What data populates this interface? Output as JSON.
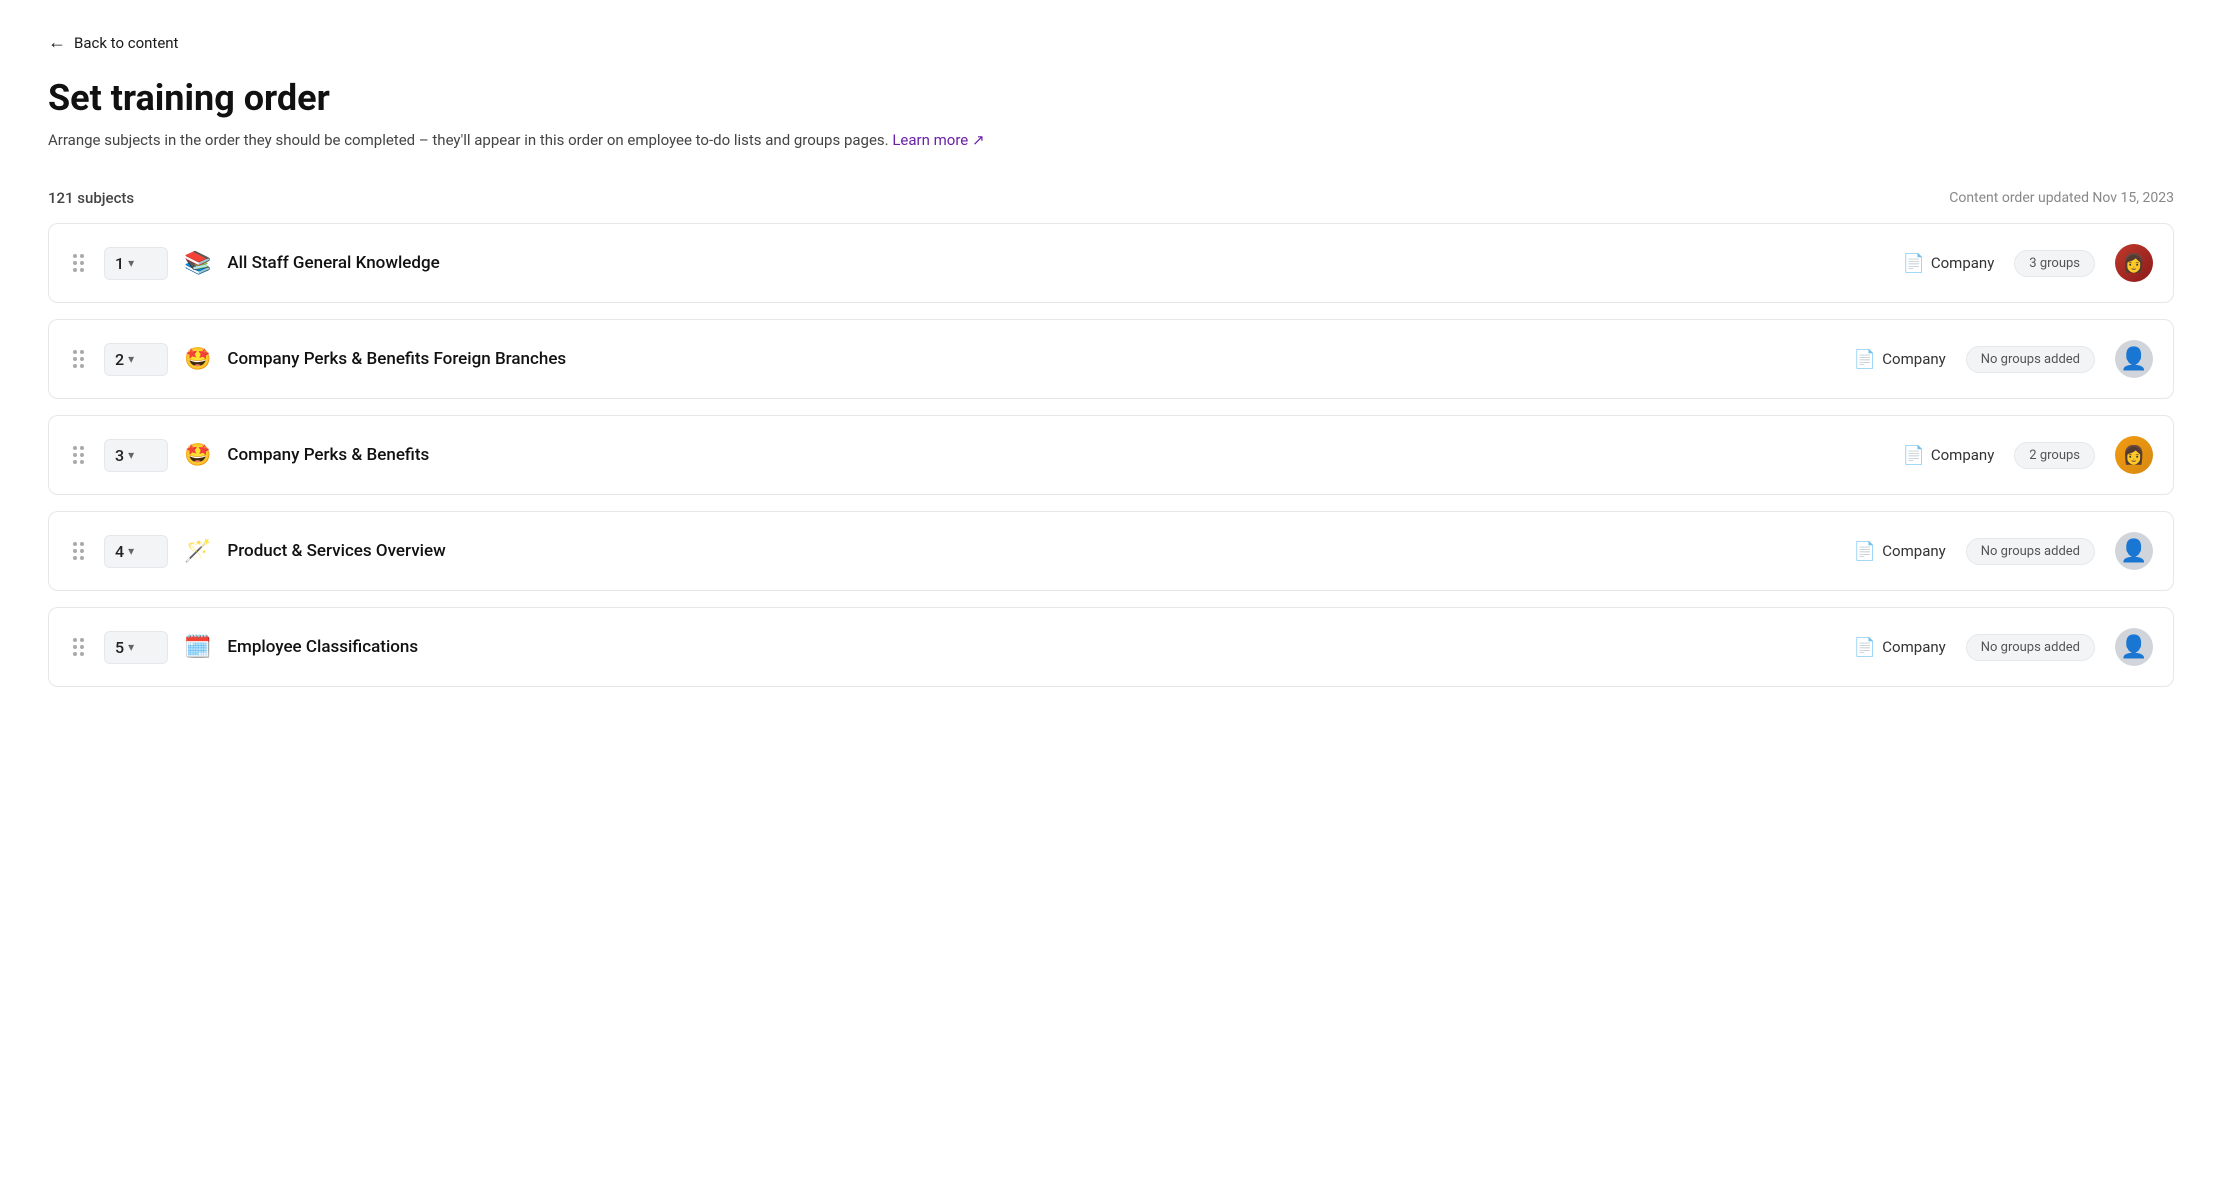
{
  "header": {
    "back_label": "Back to content",
    "title": "Set training order",
    "subtitle": "Arrange subjects in the order they should be completed – they'll appear in this order on employee to-do lists and groups pages.",
    "learn_more_label": "Learn more",
    "subject_count": "121 subjects",
    "content_order_updated": "Content order updated Nov 15, 2023"
  },
  "rows": [
    {
      "order": "1",
      "emoji": "📚",
      "name": "All Staff General Knowledge",
      "company": "Company",
      "groups_badge": "3 groups",
      "has_avatar": true,
      "avatar_type": "photo1"
    },
    {
      "order": "2",
      "emoji": "🤩",
      "name": "Company Perks & Benefits Foreign Branches",
      "company": "Company",
      "groups_badge": "No groups added",
      "has_avatar": true,
      "avatar_type": "placeholder"
    },
    {
      "order": "3",
      "emoji": "🤩",
      "name": "Company Perks & Benefits",
      "company": "Company",
      "groups_badge": "2 groups",
      "has_avatar": true,
      "avatar_type": "photo3"
    },
    {
      "order": "4",
      "emoji": "🪄",
      "name": "Product & Services Overview",
      "company": "Company",
      "groups_badge": "No groups added",
      "has_avatar": true,
      "avatar_type": "placeholder"
    },
    {
      "order": "5",
      "emoji": "🗓️",
      "name": "Employee Classifications",
      "company": "Company",
      "groups_badge": "No groups added",
      "has_avatar": true,
      "avatar_type": "placeholder"
    }
  ]
}
